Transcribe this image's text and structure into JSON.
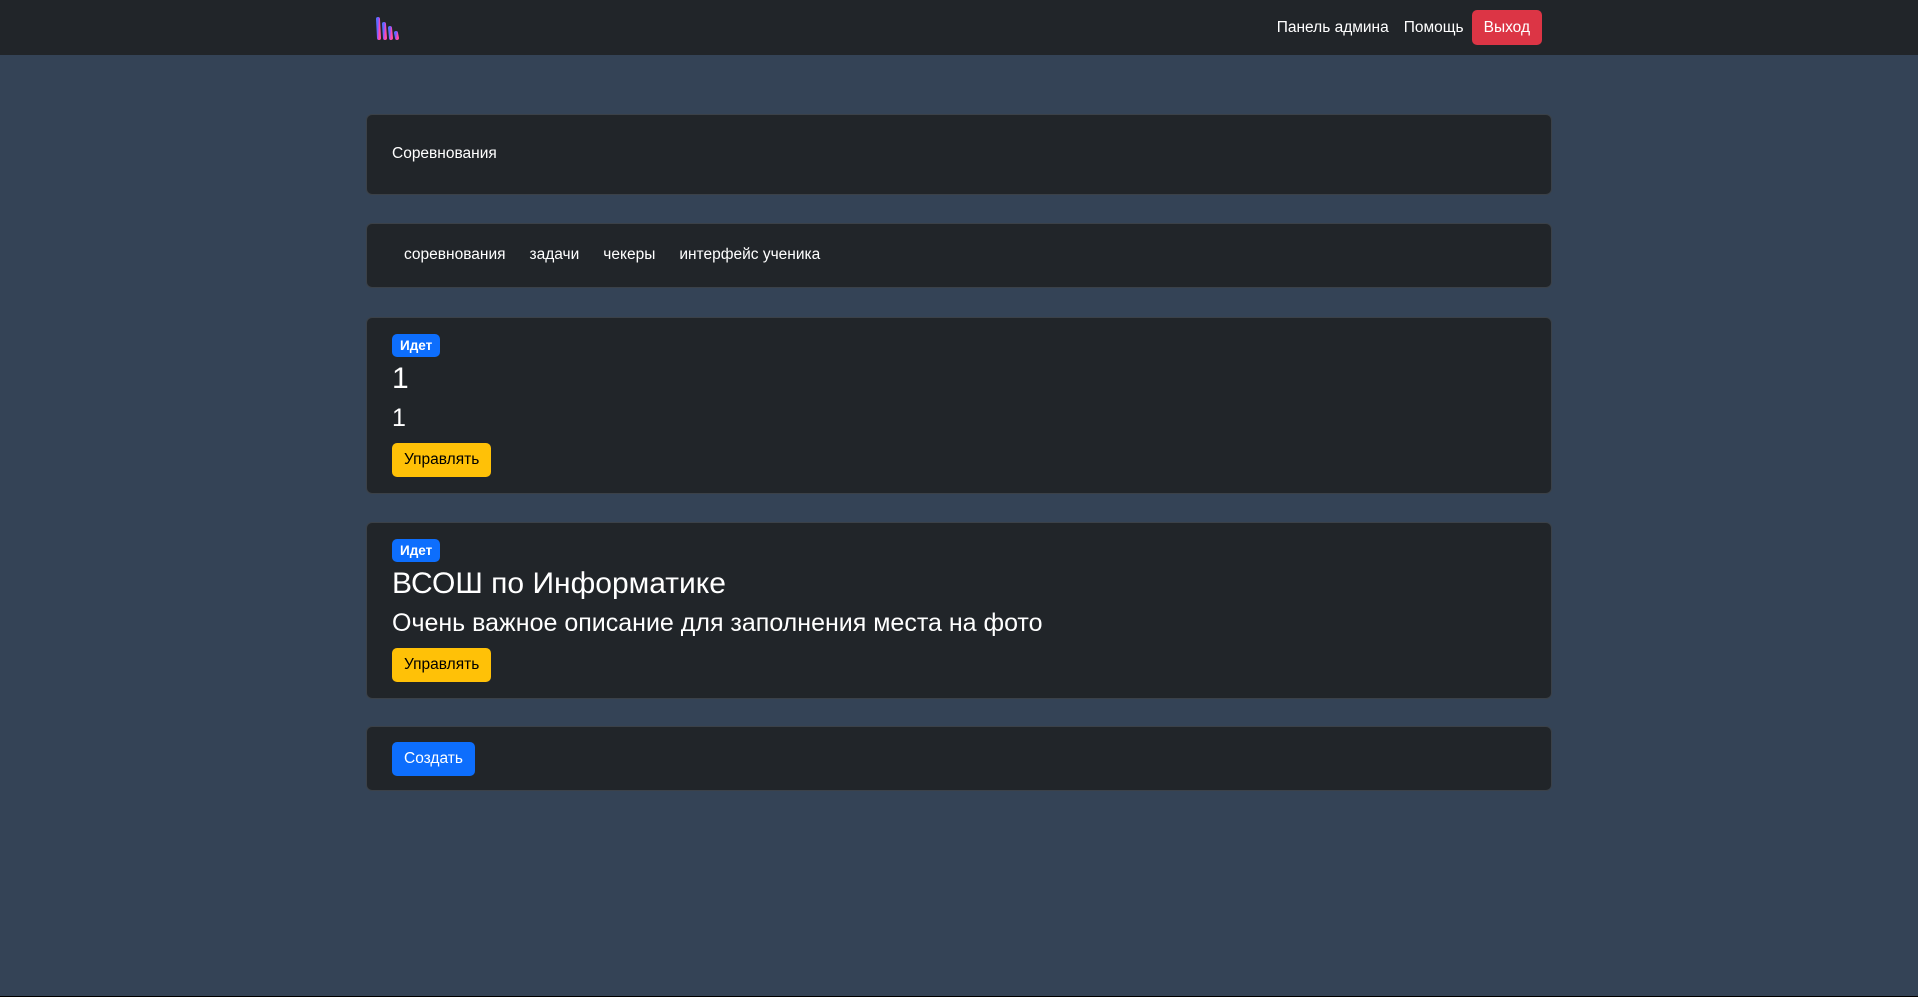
{
  "navbar": {
    "logo_icon": "brand-logo-icon",
    "links": {
      "admin_panel": "Панель админа",
      "help": "Помощь"
    },
    "logout_label": "Выход",
    "colors": {
      "background": "#212529",
      "logout": "#dc3545"
    }
  },
  "page_header": {
    "title": "Соревнования"
  },
  "tabs": [
    {
      "label": "соревнования"
    },
    {
      "label": "задачи"
    },
    {
      "label": "чекеры"
    },
    {
      "label": "интерфейс ученика"
    }
  ],
  "competitions": [
    {
      "status": "Идет",
      "name": "1",
      "description": "1",
      "manage_label": "Управлять"
    },
    {
      "status": "Идет",
      "name": "ВСОШ по Информатике",
      "description": "Очень важное описание для заполнения места на фото",
      "manage_label": "Управлять"
    }
  ],
  "create": {
    "label": "Создать"
  },
  "colors": {
    "page_background": "#344356",
    "card_background": "#212529",
    "badge": "#0d6efd",
    "manage_button": "#ffc107",
    "create_button": "#0d6efd"
  }
}
